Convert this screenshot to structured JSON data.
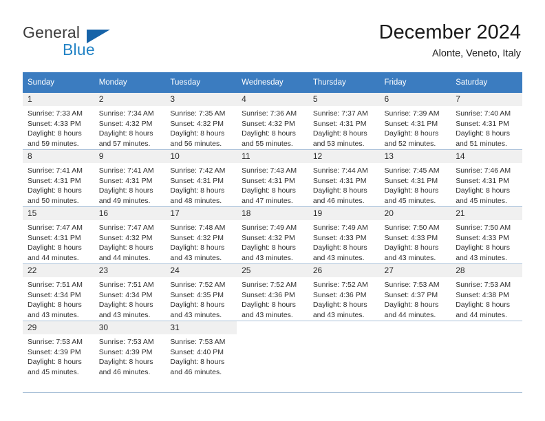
{
  "brand": {
    "name_part1": "General",
    "name_part2": "Blue",
    "triangle_color": "#1663a8",
    "blue_color": "#2383c5",
    "gray_color": "#3b3b3b"
  },
  "header": {
    "title": "December 2024",
    "subtitle": "Alonte, Veneto, Italy"
  },
  "theme": {
    "header_row_bg": "#3b7cc0",
    "header_row_text": "#ffffff",
    "daynum_band_bg": "#f0f0f0",
    "grid_line": "#a9c0d8",
    "body_text": "#2f2f2f"
  },
  "weekday_headers": [
    "Sunday",
    "Monday",
    "Tuesday",
    "Wednesday",
    "Thursday",
    "Friday",
    "Saturday"
  ],
  "labels": {
    "sunrise_prefix": "Sunrise:",
    "sunset_prefix": "Sunset:",
    "daylight_prefix": "Daylight:"
  },
  "weeks": [
    [
      {
        "day": "1",
        "sunrise": "Sunrise: 7:33 AM",
        "sunset": "Sunset: 4:33 PM",
        "daylight1": "Daylight: 8 hours",
        "daylight2": "and 59 minutes."
      },
      {
        "day": "2",
        "sunrise": "Sunrise: 7:34 AM",
        "sunset": "Sunset: 4:32 PM",
        "daylight1": "Daylight: 8 hours",
        "daylight2": "and 57 minutes."
      },
      {
        "day": "3",
        "sunrise": "Sunrise: 7:35 AM",
        "sunset": "Sunset: 4:32 PM",
        "daylight1": "Daylight: 8 hours",
        "daylight2": "and 56 minutes."
      },
      {
        "day": "4",
        "sunrise": "Sunrise: 7:36 AM",
        "sunset": "Sunset: 4:32 PM",
        "daylight1": "Daylight: 8 hours",
        "daylight2": "and 55 minutes."
      },
      {
        "day": "5",
        "sunrise": "Sunrise: 7:37 AM",
        "sunset": "Sunset: 4:31 PM",
        "daylight1": "Daylight: 8 hours",
        "daylight2": "and 53 minutes."
      },
      {
        "day": "6",
        "sunrise": "Sunrise: 7:39 AM",
        "sunset": "Sunset: 4:31 PM",
        "daylight1": "Daylight: 8 hours",
        "daylight2": "and 52 minutes."
      },
      {
        "day": "7",
        "sunrise": "Sunrise: 7:40 AM",
        "sunset": "Sunset: 4:31 PM",
        "daylight1": "Daylight: 8 hours",
        "daylight2": "and 51 minutes."
      }
    ],
    [
      {
        "day": "8",
        "sunrise": "Sunrise: 7:41 AM",
        "sunset": "Sunset: 4:31 PM",
        "daylight1": "Daylight: 8 hours",
        "daylight2": "and 50 minutes."
      },
      {
        "day": "9",
        "sunrise": "Sunrise: 7:41 AM",
        "sunset": "Sunset: 4:31 PM",
        "daylight1": "Daylight: 8 hours",
        "daylight2": "and 49 minutes."
      },
      {
        "day": "10",
        "sunrise": "Sunrise: 7:42 AM",
        "sunset": "Sunset: 4:31 PM",
        "daylight1": "Daylight: 8 hours",
        "daylight2": "and 48 minutes."
      },
      {
        "day": "11",
        "sunrise": "Sunrise: 7:43 AM",
        "sunset": "Sunset: 4:31 PM",
        "daylight1": "Daylight: 8 hours",
        "daylight2": "and 47 minutes."
      },
      {
        "day": "12",
        "sunrise": "Sunrise: 7:44 AM",
        "sunset": "Sunset: 4:31 PM",
        "daylight1": "Daylight: 8 hours",
        "daylight2": "and 46 minutes."
      },
      {
        "day": "13",
        "sunrise": "Sunrise: 7:45 AM",
        "sunset": "Sunset: 4:31 PM",
        "daylight1": "Daylight: 8 hours",
        "daylight2": "and 45 minutes."
      },
      {
        "day": "14",
        "sunrise": "Sunrise: 7:46 AM",
        "sunset": "Sunset: 4:31 PM",
        "daylight1": "Daylight: 8 hours",
        "daylight2": "and 45 minutes."
      }
    ],
    [
      {
        "day": "15",
        "sunrise": "Sunrise: 7:47 AM",
        "sunset": "Sunset: 4:31 PM",
        "daylight1": "Daylight: 8 hours",
        "daylight2": "and 44 minutes."
      },
      {
        "day": "16",
        "sunrise": "Sunrise: 7:47 AM",
        "sunset": "Sunset: 4:32 PM",
        "daylight1": "Daylight: 8 hours",
        "daylight2": "and 44 minutes."
      },
      {
        "day": "17",
        "sunrise": "Sunrise: 7:48 AM",
        "sunset": "Sunset: 4:32 PM",
        "daylight1": "Daylight: 8 hours",
        "daylight2": "and 43 minutes."
      },
      {
        "day": "18",
        "sunrise": "Sunrise: 7:49 AM",
        "sunset": "Sunset: 4:32 PM",
        "daylight1": "Daylight: 8 hours",
        "daylight2": "and 43 minutes."
      },
      {
        "day": "19",
        "sunrise": "Sunrise: 7:49 AM",
        "sunset": "Sunset: 4:33 PM",
        "daylight1": "Daylight: 8 hours",
        "daylight2": "and 43 minutes."
      },
      {
        "day": "20",
        "sunrise": "Sunrise: 7:50 AM",
        "sunset": "Sunset: 4:33 PM",
        "daylight1": "Daylight: 8 hours",
        "daylight2": "and 43 minutes."
      },
      {
        "day": "21",
        "sunrise": "Sunrise: 7:50 AM",
        "sunset": "Sunset: 4:33 PM",
        "daylight1": "Daylight: 8 hours",
        "daylight2": "and 43 minutes."
      }
    ],
    [
      {
        "day": "22",
        "sunrise": "Sunrise: 7:51 AM",
        "sunset": "Sunset: 4:34 PM",
        "daylight1": "Daylight: 8 hours",
        "daylight2": "and 43 minutes."
      },
      {
        "day": "23",
        "sunrise": "Sunrise: 7:51 AM",
        "sunset": "Sunset: 4:34 PM",
        "daylight1": "Daylight: 8 hours",
        "daylight2": "and 43 minutes."
      },
      {
        "day": "24",
        "sunrise": "Sunrise: 7:52 AM",
        "sunset": "Sunset: 4:35 PM",
        "daylight1": "Daylight: 8 hours",
        "daylight2": "and 43 minutes."
      },
      {
        "day": "25",
        "sunrise": "Sunrise: 7:52 AM",
        "sunset": "Sunset: 4:36 PM",
        "daylight1": "Daylight: 8 hours",
        "daylight2": "and 43 minutes."
      },
      {
        "day": "26",
        "sunrise": "Sunrise: 7:52 AM",
        "sunset": "Sunset: 4:36 PM",
        "daylight1": "Daylight: 8 hours",
        "daylight2": "and 43 minutes."
      },
      {
        "day": "27",
        "sunrise": "Sunrise: 7:53 AM",
        "sunset": "Sunset: 4:37 PM",
        "daylight1": "Daylight: 8 hours",
        "daylight2": "and 44 minutes."
      },
      {
        "day": "28",
        "sunrise": "Sunrise: 7:53 AM",
        "sunset": "Sunset: 4:38 PM",
        "daylight1": "Daylight: 8 hours",
        "daylight2": "and 44 minutes."
      }
    ],
    [
      {
        "day": "29",
        "sunrise": "Sunrise: 7:53 AM",
        "sunset": "Sunset: 4:39 PM",
        "daylight1": "Daylight: 8 hours",
        "daylight2": "and 45 minutes."
      },
      {
        "day": "30",
        "sunrise": "Sunrise: 7:53 AM",
        "sunset": "Sunset: 4:39 PM",
        "daylight1": "Daylight: 8 hours",
        "daylight2": "and 46 minutes."
      },
      {
        "day": "31",
        "sunrise": "Sunrise: 7:53 AM",
        "sunset": "Sunset: 4:40 PM",
        "daylight1": "Daylight: 8 hours",
        "daylight2": "and 46 minutes."
      },
      {
        "day": "",
        "sunrise": "",
        "sunset": "",
        "daylight1": "",
        "daylight2": ""
      },
      {
        "day": "",
        "sunrise": "",
        "sunset": "",
        "daylight1": "",
        "daylight2": ""
      },
      {
        "day": "",
        "sunrise": "",
        "sunset": "",
        "daylight1": "",
        "daylight2": ""
      },
      {
        "day": "",
        "sunrise": "",
        "sunset": "",
        "daylight1": "",
        "daylight2": ""
      }
    ]
  ]
}
